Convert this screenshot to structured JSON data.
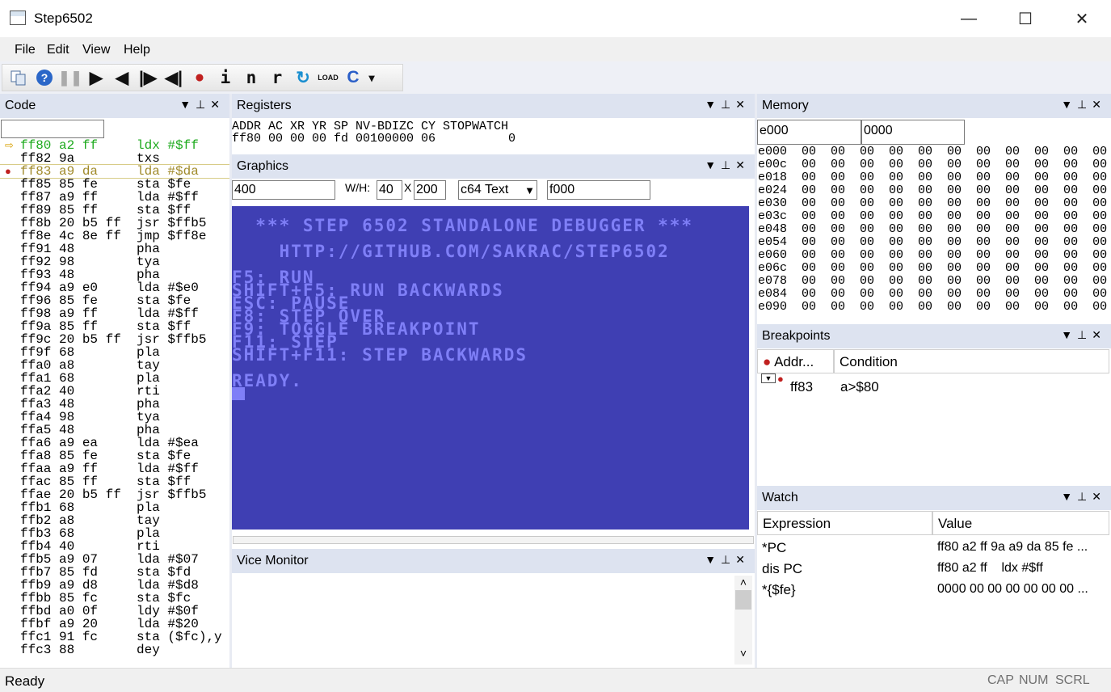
{
  "window": {
    "title": "Step6502",
    "minimize": "—",
    "maximize": "☐",
    "close": "✕"
  },
  "menu": [
    "File",
    "Edit",
    "View",
    "Help"
  ],
  "toolbar": {
    "icons": [
      "copy-icon",
      "help-icon",
      "pause-icon",
      "run-icon",
      "step-back-icon",
      "step-forward-icon",
      "run-backwards-icon",
      "breakpoint-icon",
      "step-into-icon",
      "step-over-icon",
      "step-out-icon",
      "reload-icon",
      "load-icon",
      "c64-icon",
      "overflow-icon"
    ],
    "labels": {
      "help": "?",
      "pause": "❚❚",
      "run": "▶",
      "step_back": "◀",
      "step_fwd": "|▶",
      "run_back": "◀|",
      "bp": "●",
      "i": "i",
      "n": "n",
      "r": "r",
      "reload": "↻",
      "load": "LOAD",
      "c64": "C",
      "more": "▾"
    }
  },
  "code": {
    "title": "Code",
    "lines": [
      {
        "text": "ff80 a2 ff     ldx #$ff",
        "mark": "arrow",
        "style": "current"
      },
      {
        "text": "ff82 9a        txs",
        "mark": "",
        "style": ""
      },
      {
        "text": "ff83 a9 da     lda #$da",
        "mark": "bp",
        "style": "bp"
      },
      {
        "text": "ff85 85 fe     sta $fe",
        "mark": "",
        "style": ""
      },
      {
        "text": "ff87 a9 ff     lda #$ff",
        "mark": "",
        "style": ""
      },
      {
        "text": "ff89 85 ff     sta $ff",
        "mark": "",
        "style": ""
      },
      {
        "text": "ff8b 20 b5 ff  jsr $ffb5",
        "mark": "",
        "style": ""
      },
      {
        "text": "ff8e 4c 8e ff  jmp $ff8e",
        "mark": "",
        "style": ""
      },
      {
        "text": "ff91 48        pha",
        "mark": "",
        "style": ""
      },
      {
        "text": "ff92 98        tya",
        "mark": "",
        "style": ""
      },
      {
        "text": "ff93 48        pha",
        "mark": "",
        "style": ""
      },
      {
        "text": "ff94 a9 e0     lda #$e0",
        "mark": "",
        "style": ""
      },
      {
        "text": "ff96 85 fe     sta $fe",
        "mark": "",
        "style": ""
      },
      {
        "text": "ff98 a9 ff     lda #$ff",
        "mark": "",
        "style": ""
      },
      {
        "text": "ff9a 85 ff     sta $ff",
        "mark": "",
        "style": ""
      },
      {
        "text": "ff9c 20 b5 ff  jsr $ffb5",
        "mark": "",
        "style": ""
      },
      {
        "text": "ff9f 68        pla",
        "mark": "",
        "style": ""
      },
      {
        "text": "ffa0 a8        tay",
        "mark": "",
        "style": ""
      },
      {
        "text": "ffa1 68        pla",
        "mark": "",
        "style": ""
      },
      {
        "text": "ffa2 40        rti",
        "mark": "",
        "style": ""
      },
      {
        "text": "ffa3 48        pha",
        "mark": "",
        "style": ""
      },
      {
        "text": "ffa4 98        tya",
        "mark": "",
        "style": ""
      },
      {
        "text": "ffa5 48        pha",
        "mark": "",
        "style": ""
      },
      {
        "text": "ffa6 a9 ea     lda #$ea",
        "mark": "",
        "style": ""
      },
      {
        "text": "ffa8 85 fe     sta $fe",
        "mark": "",
        "style": ""
      },
      {
        "text": "ffaa a9 ff     lda #$ff",
        "mark": "",
        "style": ""
      },
      {
        "text": "ffac 85 ff     sta $ff",
        "mark": "",
        "style": ""
      },
      {
        "text": "ffae 20 b5 ff  jsr $ffb5",
        "mark": "",
        "style": ""
      },
      {
        "text": "ffb1 68        pla",
        "mark": "",
        "style": ""
      },
      {
        "text": "ffb2 a8        tay",
        "mark": "",
        "style": ""
      },
      {
        "text": "ffb3 68        pla",
        "mark": "",
        "style": ""
      },
      {
        "text": "ffb4 40        rti",
        "mark": "",
        "style": ""
      },
      {
        "text": "ffb5 a9 07     lda #$07",
        "mark": "",
        "style": ""
      },
      {
        "text": "ffb7 85 fd     sta $fd",
        "mark": "",
        "style": ""
      },
      {
        "text": "ffb9 a9 d8     lda #$d8",
        "mark": "",
        "style": ""
      },
      {
        "text": "ffbb 85 fc     sta $fc",
        "mark": "",
        "style": ""
      },
      {
        "text": "ffbd a0 0f     ldy #$0f",
        "mark": "",
        "style": ""
      },
      {
        "text": "ffbf a9 20     lda #$20",
        "mark": "",
        "style": ""
      },
      {
        "text": "ffc1 91 fc     sta ($fc),y",
        "mark": "",
        "style": ""
      },
      {
        "text": "ffc3 88        dey",
        "mark": "",
        "style": ""
      }
    ]
  },
  "registers": {
    "title": "Registers",
    "header": "ADDR AC XR YR SP NV-BDIZC CY STOPWATCH",
    "values": "ff80 00 00 00 fd 00100000 06          0"
  },
  "graphics": {
    "title": "Graphics",
    "address": "400",
    "wh_label": "W/H:",
    "width": "40",
    "x_label": "X",
    "height": "200",
    "mode": "c64 Text",
    "mode_arrow": "▼",
    "font_addr": "f000",
    "screen": [
      "",
      "  *** STEP 6502 STANDALONE DEBUGGER ***",
      "",
      "    HTTP://GITHUB.COM/SAKRAC/STEP6502",
      "",
      "F5: RUN",
      "SHIFT+F5: RUN BACKWARDS",
      "ESC: PAUSE",
      "F8: STEP OVER",
      "F9: TOGGLE BREAKPOINT",
      "F11: STEP",
      "SHIFT+F11: STEP BACKWARDS",
      "",
      "READY."
    ]
  },
  "vice": {
    "title": "Vice Monitor",
    "up": "˄",
    "down": "˅"
  },
  "memory": {
    "title": "Memory",
    "addr": "e000",
    "count": "0000",
    "rows": [
      "e000  00  00  00  00  00  00  00  00  00  00  00  00",
      "e00c  00  00  00  00  00  00  00  00  00  00  00  00",
      "e018  00  00  00  00  00  00  00  00  00  00  00  00",
      "e024  00  00  00  00  00  00  00  00  00  00  00  00",
      "e030  00  00  00  00  00  00  00  00  00  00  00  00",
      "e03c  00  00  00  00  00  00  00  00  00  00  00  00",
      "e048  00  00  00  00  00  00  00  00  00  00  00  00",
      "e054  00  00  00  00  00  00  00  00  00  00  00  00",
      "e060  00  00  00  00  00  00  00  00  00  00  00  00",
      "e06c  00  00  00  00  00  00  00  00  00  00  00  00",
      "e078  00  00  00  00  00  00  00  00  00  00  00  00",
      "e084  00  00  00  00  00  00  00  00  00  00  00  00",
      "e090  00  00  00  00  00  00  00  00  00  00  00  00"
    ]
  },
  "breakpoints": {
    "title": "Breakpoints",
    "col_addr": "Addr...",
    "col_cond": "Condition",
    "rows": [
      {
        "addr": "ff83",
        "cond": "a>$80"
      }
    ]
  },
  "watch": {
    "title": "Watch",
    "col_expr": "Expression",
    "col_value": "Value",
    "rows": [
      {
        "expr": "*PC",
        "value": "ff80 a2 ff 9a a9 da 85 fe ..."
      },
      {
        "expr": "dis PC",
        "value": "ff80 a2 ff    ldx #$ff"
      },
      {
        "expr": "*{$fe}",
        "value": "0000 00 00 00 00 00 00 ..."
      }
    ]
  },
  "status": {
    "text": "Ready",
    "cap": "CAP",
    "num": "NUM",
    "scrl": "SCRL"
  },
  "colors": {
    "code_current": "#1eaa1e",
    "code_bp": "#a08a2a",
    "c64_bg": "#3f3fb3",
    "c64_fg": "#7f7ff7",
    "pane_header": "#dde3f0"
  }
}
